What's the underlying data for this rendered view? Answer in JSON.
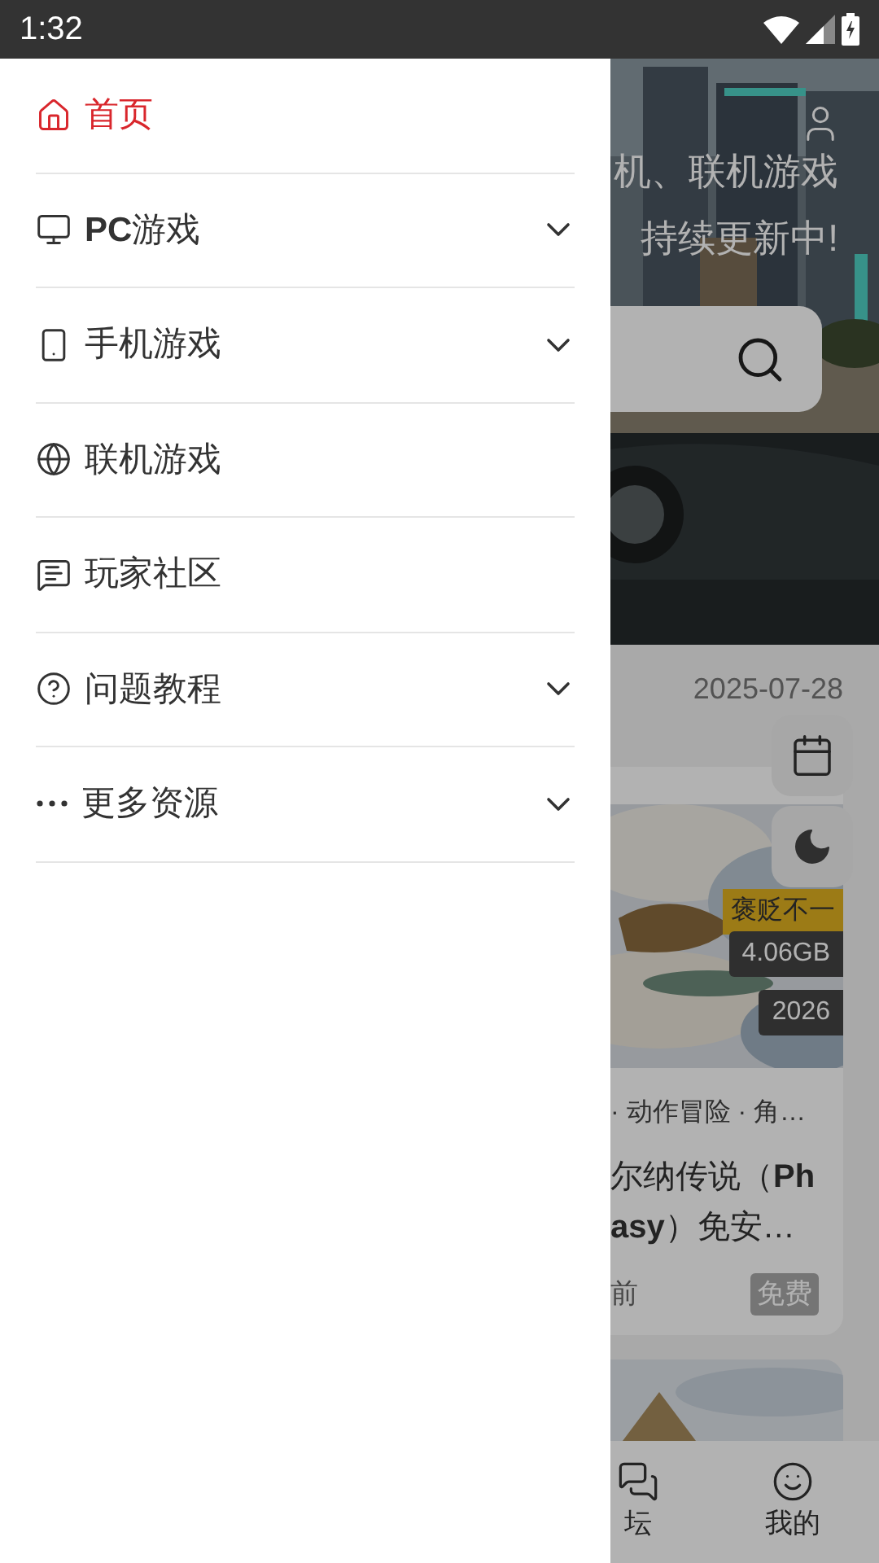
{
  "status_bar": {
    "time": "1:32"
  },
  "drawer": {
    "items": [
      {
        "label": "首页",
        "selected": true,
        "has_submenu": false
      },
      {
        "label": "**PC**游戏",
        "selected": false,
        "has_submenu": true
      },
      {
        "label": "手机游戏",
        "selected": false,
        "has_submenu": true
      },
      {
        "label": "联机游戏",
        "selected": false,
        "has_submenu": false
      },
      {
        "label": "玩家社区",
        "selected": false,
        "has_submenu": false
      },
      {
        "label": "问题教程",
        "selected": false,
        "has_submenu": true
      },
      {
        "label": "更多资源",
        "selected": false,
        "has_submenu": true
      }
    ]
  },
  "background_page": {
    "banner": {
      "line_1": "机、联机游戏",
      "line_2": "持续更新中!"
    },
    "date": "2025-07-28",
    "card": {
      "rating_tag": "褒贬不一",
      "size": "4.06GB",
      "year": "2026",
      "genres": "· 动作冒险 · 角…",
      "title_line_1": "尔纳传说（**Ph**",
      "title_line_2": "**asy**）免安…",
      "time": "前",
      "price": "免费"
    },
    "bottom_nav": [
      {
        "label": "坛"
      },
      {
        "label": "我的"
      }
    ]
  }
}
